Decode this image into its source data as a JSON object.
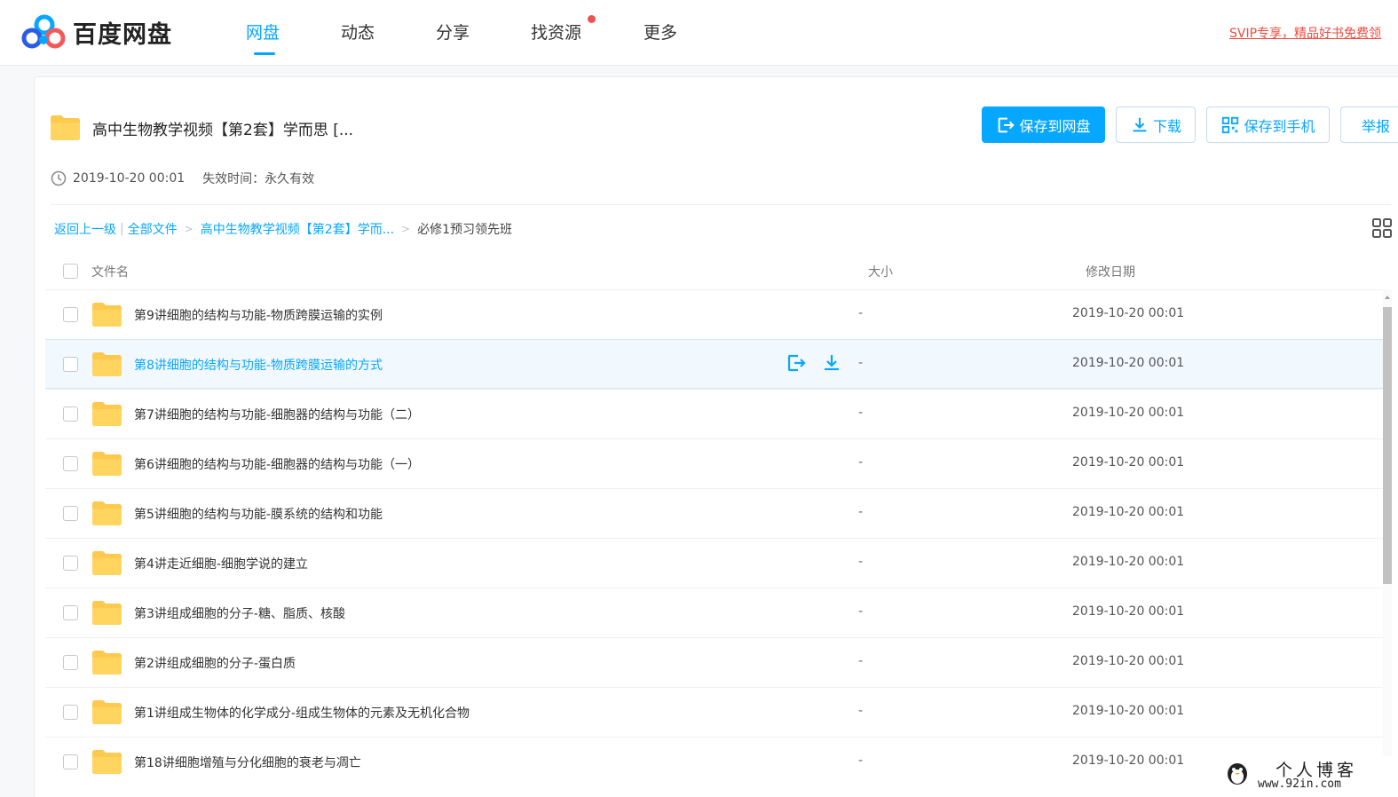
{
  "app": {
    "name": "百度网盘"
  },
  "nav": {
    "items": [
      {
        "label": "网盘",
        "active": true
      },
      {
        "label": "动态"
      },
      {
        "label": "分享"
      },
      {
        "label": "找资源",
        "has_dot": true
      },
      {
        "label": "更多"
      }
    ],
    "promo": "SVIP专享，精品好书免费领"
  },
  "share": {
    "title": "高中生物教学视频【第2套】学而思  [...",
    "time": "2019-10-20 00:01",
    "expire": "失效时间：永久有效",
    "buttons": {
      "save": "保存到网盘",
      "download": "下载",
      "save_phone": "保存到手机",
      "report": "举报"
    }
  },
  "breadcrumb": {
    "back": "返回上一级",
    "sep": "|",
    "all": "全部文件",
    "parent": "高中生物教学视频【第2套】学而...",
    "arrow": ">",
    "current": "必修1预习领先班"
  },
  "table": {
    "headers": {
      "name": "文件名",
      "size": "大小",
      "date": "修改日期"
    },
    "rows": [
      {
        "name": "第9讲细胞的结构与功能-物质跨膜运输的实例",
        "size": "-",
        "date": "2019-10-20 00:01"
      },
      {
        "name": "第8讲细胞的结构与功能-物质跨膜运输的方式",
        "size": "-",
        "date": "2019-10-20 00:01",
        "hover": true
      },
      {
        "name": "第7讲细胞的结构与功能-细胞器的结构与功能（二）",
        "size": "-",
        "date": "2019-10-20 00:01"
      },
      {
        "name": "第6讲细胞的结构与功能-细胞器的结构与功能（一）",
        "size": "-",
        "date": "2019-10-20 00:01"
      },
      {
        "name": "第5讲细胞的结构与功能-膜系统的结构和功能",
        "size": "-",
        "date": "2019-10-20 00:01"
      },
      {
        "name": "第4讲走近细胞-细胞学说的建立",
        "size": "-",
        "date": "2019-10-20 00:01"
      },
      {
        "name": "第3讲组成细胞的分子-糖、脂质、核酸",
        "size": "-",
        "date": "2019-10-20 00:01"
      },
      {
        "name": "第2讲组成细胞的分子-蛋白质",
        "size": "-",
        "date": "2019-10-20 00:01"
      },
      {
        "name": "第1讲组成生物体的化学成分-组成生物体的元素及无机化合物",
        "size": "-",
        "date": "2019-10-20 00:01"
      },
      {
        "name": "第18讲细胞增殖与分化细胞的衰老与凋亡",
        "size": "-",
        "date": "2019-10-20 00:01"
      }
    ]
  },
  "watermark": {
    "title": "个人博客",
    "url": "www.92in.com"
  },
  "colors": {
    "accent": "#06a7ff",
    "folder": "#ffc94d",
    "promo": "#f24a3d"
  }
}
